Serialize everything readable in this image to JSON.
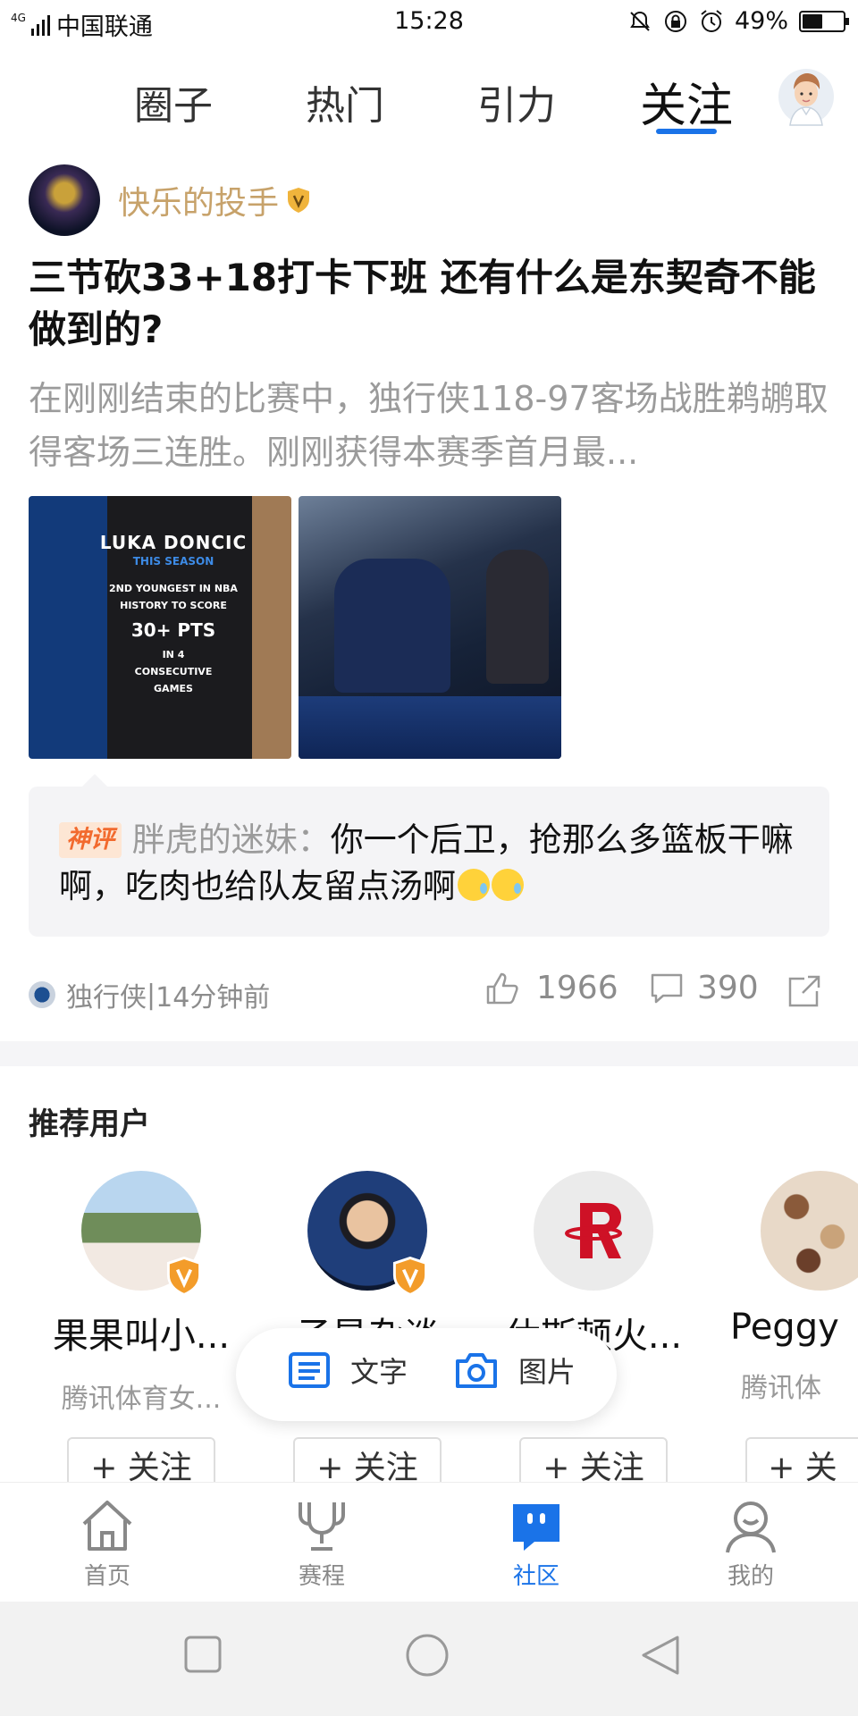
{
  "status_bar": {
    "network": "4G",
    "carrier": "中国联通",
    "time": "15:28",
    "battery_percent": "49%",
    "battery_level": 0.49
  },
  "top_tabs": [
    {
      "label": "圈子"
    },
    {
      "label": "热门"
    },
    {
      "label": "引力"
    },
    {
      "label": "关注",
      "active": true
    }
  ],
  "post": {
    "author": "快乐的投手",
    "title": "三节砍33+18打卡下班 还有什么是东契奇不能做到的?",
    "excerpt": "在刚刚结束的比赛中，独行侠118-97客场战胜鹈鹕取得客场三连胜。刚刚获得本赛季首月最...",
    "image1": {
      "line1": "LUKA DONCIC",
      "line2": "THIS SEASON",
      "line3": "2ND YOUNGEST IN NBA",
      "line4": "HISTORY TO SCORE",
      "line5": "30+ PTS",
      "line6": "IN 4",
      "line7": "CONSECUTIVE",
      "line8": "GAMES"
    },
    "hot_comment": {
      "badge": "神评",
      "commenter": "胖虎的迷妹：",
      "text": "你一个后卫，抢那么多篮板干嘛啊，吃肉也给队友留点汤啊"
    },
    "team": "独行侠",
    "separator": " | ",
    "time_ago": "14分钟前",
    "likes": "1966",
    "comments": "390"
  },
  "recommended": {
    "title": "推荐用户",
    "users": [
      {
        "name": "果果叫小...",
        "sub": "腾讯体育女...",
        "follow": "+ 关注"
      },
      {
        "name": "子星杂谈",
        "sub": "",
        "follow": "+ 关注"
      },
      {
        "name": "休斯顿火...",
        "sub": "",
        "follow": "+ 关注"
      },
      {
        "name": "Peggy",
        "sub": "腾讯体",
        "follow": "+ 关"
      }
    ]
  },
  "compose": {
    "text_label": "文字",
    "image_label": "图片"
  },
  "bottom_nav": [
    {
      "label": "首页"
    },
    {
      "label": "赛程"
    },
    {
      "label": "社区",
      "active": true
    },
    {
      "label": "我的"
    }
  ],
  "colors": {
    "accent": "#1a73e8",
    "author_gold": "#c7a26a",
    "hot_badge": "#f26a2e",
    "vip_badge": "#f39c2a"
  }
}
